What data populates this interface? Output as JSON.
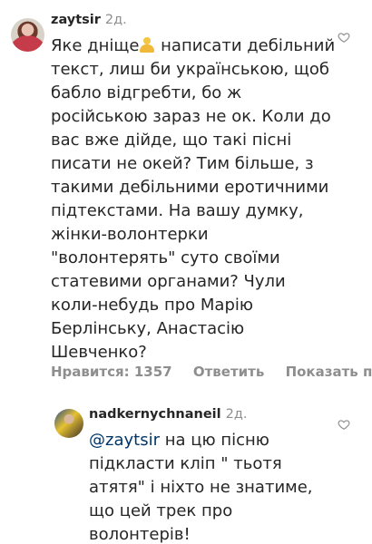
{
  "comments": [
    {
      "username": "zaytsir",
      "time": "2д.",
      "text_before_emoji": "Яке дніще",
      "text_after_emoji": " написати дебільний текст, лиш би українською, щоб бабло відгребти, бо ж російською зараз не ок. Коли до вас вже дійде, що такі пісні писати не окей? Тим більше, з такими дебільними еротичними підтекстами. На вашу думку, жінки-волонтерки \"волонтерять\" суто своїми статевими органами? Чули коли-небудь про Марію Берлінську, Анастасію Шевченко?",
      "likes_label": "Нравится: 1357",
      "reply_label": "Ответить",
      "send_label": "Показать пе"
    },
    {
      "username": "nadkernychnaneil",
      "time": "2д.",
      "mention": "@zaytsir",
      "text": " на цю пісню підкласти кліп \" тьотя атятя\" і ніхто не знатиме, що цей трек про волонтерів!"
    }
  ],
  "icons": {
    "like": "heart-outline-icon",
    "emoji": "person-emoji-icon"
  }
}
